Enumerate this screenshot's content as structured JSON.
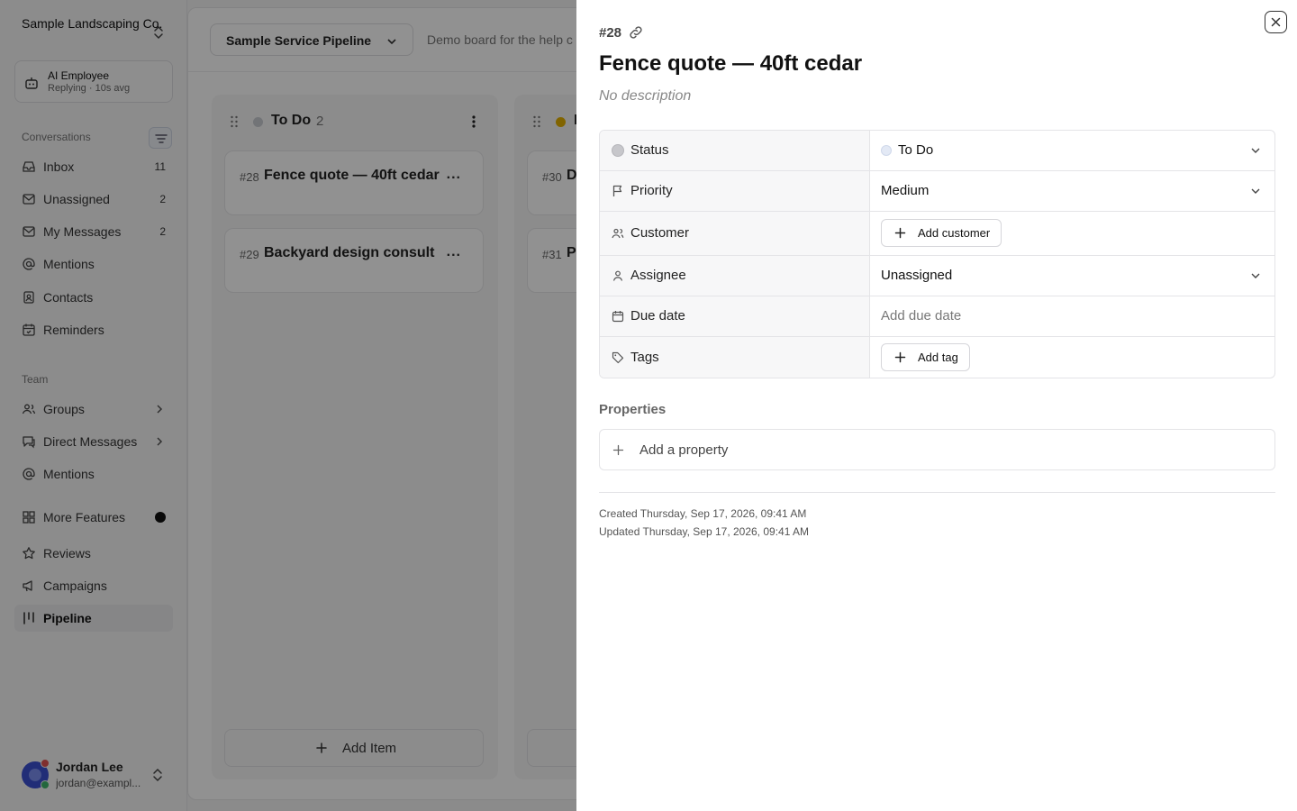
{
  "sidebar": {
    "workspace_name": "Sample Landscaping Co.",
    "ai_employee": {
      "title": "AI Employee",
      "subtitle": "Replying · 10s avg"
    },
    "conversations_label": "Conversations",
    "conversations": [
      {
        "label": "Inbox",
        "count": "11",
        "icon": "inbox-icon"
      },
      {
        "label": "Unassigned",
        "count": "2",
        "icon": "mail-icon"
      },
      {
        "label": "My Messages",
        "count": "2",
        "icon": "mail-icon"
      },
      {
        "label": "Mentions",
        "count": "",
        "icon": "at-icon"
      },
      {
        "label": "Contacts",
        "count": "",
        "icon": "contacts-icon"
      },
      {
        "label": "Reminders",
        "count": "",
        "icon": "calendar-icon"
      }
    ],
    "team_label": "Team",
    "team": [
      {
        "label": "Groups",
        "icon": "users-icon"
      },
      {
        "label": "Direct Messages",
        "icon": "chat-icon"
      },
      {
        "label": "Mentions",
        "icon": "at-icon"
      }
    ],
    "more_features": "More Features",
    "apps": [
      {
        "label": "Reviews",
        "icon": "star-icon"
      },
      {
        "label": "Campaigns",
        "icon": "megaphone-icon"
      },
      {
        "label": "Pipeline",
        "icon": "pipeline-icon",
        "active": true
      }
    ],
    "user": {
      "name": "Jordan Lee",
      "email": "jordan@exampl..."
    }
  },
  "board": {
    "pipeline_name": "Sample Service Pipeline",
    "description": "Demo board for the help c",
    "columns": [
      {
        "title": "To Do",
        "count": "2",
        "dot_color": "#c9ccd1",
        "cards": [
          {
            "id": "#28",
            "title": "Fence quote — 40ft cedar",
            "more": "..."
          },
          {
            "id": "#29",
            "title": "Backyard design consult",
            "more": "..."
          }
        ],
        "add_label": "Add Item"
      },
      {
        "title": "I",
        "count": "",
        "dot_color": "#e3b000",
        "cards": [
          {
            "id": "#30",
            "title": "D",
            "more": ""
          },
          {
            "id": "#31",
            "title": "Pa",
            "more": ""
          }
        ],
        "add_label": ""
      }
    ]
  },
  "drawer": {
    "id": "#28",
    "title": "Fence quote — 40ft cedar",
    "description": "No description",
    "fields": {
      "status": {
        "label": "Status",
        "value": "To Do"
      },
      "priority": {
        "label": "Priority",
        "value": "Medium"
      },
      "customer": {
        "label": "Customer",
        "button": "Add customer"
      },
      "assignee": {
        "label": "Assignee",
        "value": "Unassigned"
      },
      "due_date": {
        "label": "Due date",
        "placeholder": "Add due date"
      },
      "tags": {
        "label": "Tags",
        "button": "Add tag"
      }
    },
    "properties_title": "Properties",
    "add_property": "Add a property",
    "created": "Created Thursday, Sep 17, 2026, 09:41 AM",
    "updated": "Updated Thursday, Sep 17, 2026, 09:41 AM"
  }
}
